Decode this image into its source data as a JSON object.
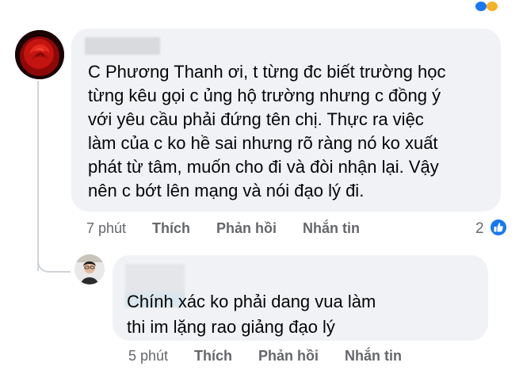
{
  "top": {
    "partial_text": ""
  },
  "colors": {
    "brand": "#1877f2",
    "bubble": "#f0f2f5",
    "muted": "#65676b"
  },
  "comment": {
    "text": "C Phương Thanh ơi, t từng đc biết trường học\ntừng kêu gọi c ủng hộ trường nhưng c đồng ý\nvới yêu cầu phải đứng tên chị. Thực ra việc\nlàm của c ko hề sai nhưng rõ ràng nó ko xuất\nphát từ tâm, muốn cho đi và đòi nhận lại. Vậy\nnên c bớt lên mạng và nói đạo lý đi.",
    "time": "7 phút",
    "like_label": "Thích",
    "reply_label": "Phản hồi",
    "message_label": "Nhắn tin",
    "reaction_count": "2",
    "reaction_icon": "like-icon"
  },
  "reply": {
    "text": "Chính xác ko phải dang vua  làm\nthi im lặng rao giảng đạo lý",
    "time": "5 phút",
    "like_label": "Thích",
    "reply_label": "Phản hồi",
    "message_label": "Nhắn tin"
  }
}
